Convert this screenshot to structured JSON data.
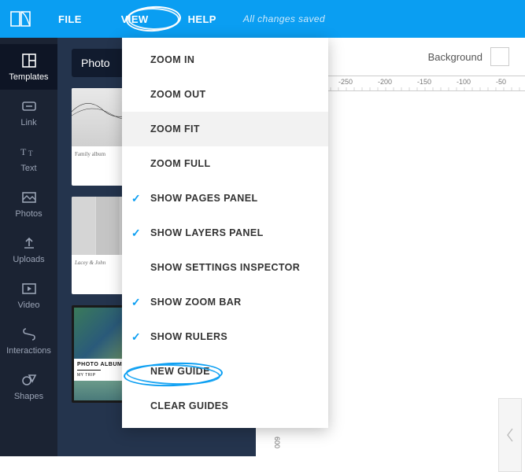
{
  "topbar": {
    "menu": [
      "FILE",
      "VIEW",
      "HELP"
    ],
    "saved": "All changes saved"
  },
  "sidebar": {
    "items": [
      {
        "label": "Templates"
      },
      {
        "label": "Link"
      },
      {
        "label": "Text"
      },
      {
        "label": "Photos"
      },
      {
        "label": "Uploads"
      },
      {
        "label": "Video"
      },
      {
        "label": "Interactions"
      },
      {
        "label": "Shapes"
      }
    ]
  },
  "templates": {
    "search_value": "Photo",
    "cards": [
      {
        "caption": "Family album"
      },
      {
        "caption": ""
      },
      {
        "caption": "Lacey & John"
      },
      {
        "caption": ""
      },
      {
        "caption": "PHOTO ALBUM",
        "sub": "MY TRIP"
      },
      {
        "caption": ""
      }
    ]
  },
  "canvas": {
    "bg_label": "Background",
    "ruler_ticks": [
      "-250",
      "-200",
      "-150",
      "-100",
      "-50"
    ],
    "ruler_v_tick": "600"
  },
  "dropdown": {
    "items": [
      {
        "label": "ZOOM IN",
        "checked": false
      },
      {
        "label": "ZOOM OUT",
        "checked": false
      },
      {
        "label": "ZOOM FIT",
        "checked": false,
        "hover": true
      },
      {
        "label": "ZOOM FULL",
        "checked": false
      },
      {
        "label": "SHOW PAGES PANEL",
        "checked": true
      },
      {
        "label": "SHOW LAYERS PANEL",
        "checked": true
      },
      {
        "label": "SHOW SETTINGS INSPECTOR",
        "checked": false
      },
      {
        "label": "SHOW ZOOM BAR",
        "checked": true
      },
      {
        "label": "SHOW RULERS",
        "checked": true
      },
      {
        "label": "NEW GUIDE",
        "checked": false
      },
      {
        "label": "CLEAR GUIDES",
        "checked": false
      }
    ]
  }
}
